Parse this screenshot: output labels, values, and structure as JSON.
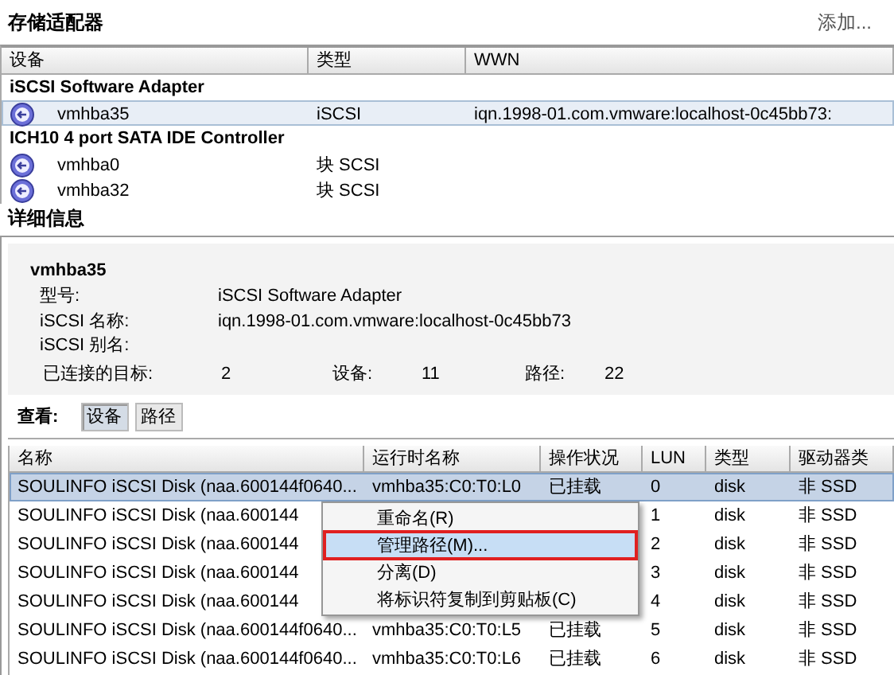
{
  "title": "存储适配器",
  "add_link": "添加...",
  "adapters": {
    "columns": [
      "设备",
      "类型",
      "WWN"
    ],
    "groups": [
      {
        "name": "iSCSI Software Adapter",
        "items": [
          {
            "name": "vmhba35",
            "type": "iSCSI",
            "wwn": "iqn.1998-01.com.vmware:localhost-0c45bb73:",
            "selected": true
          }
        ]
      },
      {
        "name": "ICH10 4 port SATA IDE Controller",
        "items": [
          {
            "name": "vmhba0",
            "type": "块 SCSI",
            "selected": false
          },
          {
            "name": "vmhba32",
            "type": "块 SCSI",
            "selected": false
          }
        ]
      }
    ]
  },
  "details": {
    "heading": "详细信息",
    "adapter": "vmhba35",
    "fields": [
      {
        "label": "型号:",
        "value": "iSCSI Software Adapter"
      },
      {
        "label": "iSCSI 名称:",
        "value": "iqn.1998-01.com.vmware:localhost-0c45bb73"
      },
      {
        "label": "iSCSI 别名:"
      }
    ],
    "stats": [
      {
        "label": "已连接的目标:",
        "value": "2"
      },
      {
        "label": "设备:",
        "value": "11"
      },
      {
        "label": "路径:",
        "value": "22"
      }
    ],
    "view_label": "查看:",
    "views": [
      {
        "label": "设备",
        "selected": true
      },
      {
        "label": "路径",
        "selected": false
      }
    ]
  },
  "devices": {
    "columns": [
      "名称",
      "运行时名称",
      "操作状况",
      "LUN",
      "类型",
      "驱动器类"
    ],
    "rows": [
      {
        "name": "SOULINFO iSCSI Disk (naa.600144f0640...",
        "runtime": "vmhba35:C0:T0:L0",
        "status": "已挂载",
        "lun": "0",
        "type": "disk",
        "drive": "非 SSD",
        "selected": true
      },
      {
        "name": "SOULINFO iSCSI Disk (naa.600144",
        "lun": "1",
        "type": "disk",
        "drive": "非 SSD",
        "selected": false
      },
      {
        "name": "SOULINFO iSCSI Disk (naa.600144",
        "lun": "2",
        "type": "disk",
        "drive": "非 SSD",
        "selected": false
      },
      {
        "name": "SOULINFO iSCSI Disk (naa.600144",
        "lun": "3",
        "type": "disk",
        "drive": "非 SSD",
        "selected": false
      },
      {
        "name": "SOULINFO iSCSI Disk (naa.600144",
        "lun": "4",
        "type": "disk",
        "drive": "非 SSD",
        "selected": false
      },
      {
        "name": "SOULINFO iSCSI Disk (naa.600144f0640...",
        "runtime": "vmhba35:C0:T0:L5",
        "status": "已挂载",
        "lun": "5",
        "type": "disk",
        "drive": "非 SSD",
        "selected": false
      },
      {
        "name": "SOULINFO iSCSI Disk (naa.600144f0640...",
        "runtime": "vmhba35:C0:T0:L6",
        "status": "已挂载",
        "lun": "6",
        "type": "disk",
        "drive": "非 SSD",
        "selected": false
      }
    ]
  },
  "context_menu": [
    {
      "label": "重命名(R)",
      "selected": false
    },
    {
      "label": "管理路径(M)...",
      "selected": true
    },
    {
      "label": "分离(D)",
      "selected": false
    },
    {
      "label": "将标识符复制到剪贴板(C)",
      "selected": false
    }
  ]
}
